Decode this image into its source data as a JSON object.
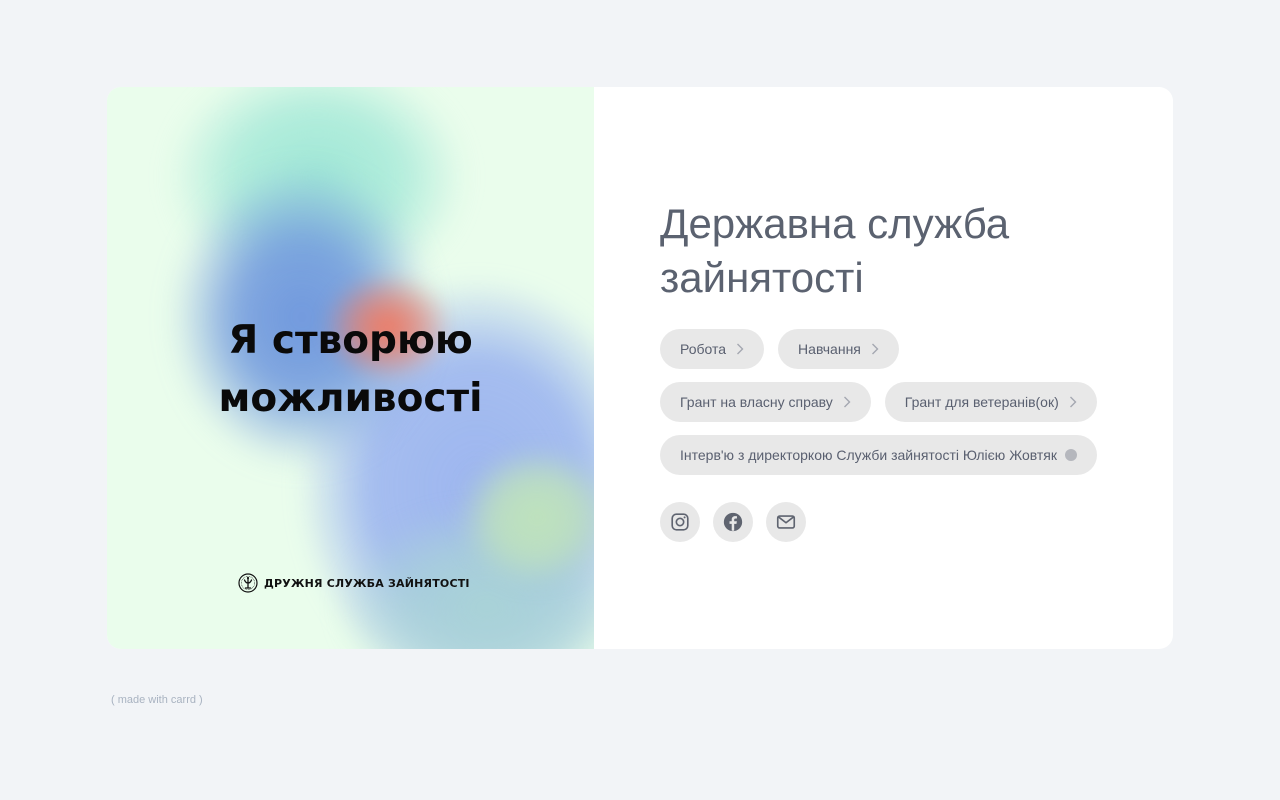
{
  "hero": {
    "headline_line1": "Я створюю",
    "headline_line2": "можливості",
    "logo_text": "ДРУЖНЯ СЛУЖБА ЗАЙНЯТОСТІ"
  },
  "main": {
    "title_line1": "Державна служба",
    "title_line2": "зайнятості",
    "buttons": [
      {
        "label": "Робота",
        "icon": "chevron-right-icon"
      },
      {
        "label": "Навчання",
        "icon": "chevron-right-icon"
      },
      {
        "label": "Грант на власну справу",
        "icon": "chevron-right-icon"
      },
      {
        "label": "Грант для ветеранів(ок)",
        "icon": "chevron-right-icon"
      },
      {
        "label": "Інтерв'ю з директоркою Служби зайнятості Юлією Жовтяк",
        "icon": "dot-icon"
      }
    ],
    "socials": [
      {
        "icon": "instagram-icon"
      },
      {
        "icon": "facebook-icon"
      },
      {
        "icon": "email-icon"
      }
    ]
  },
  "footer": {
    "credit": "( made with carrd )"
  },
  "colors": {
    "page_background": "#f2f4f7",
    "card_background": "#ffffff",
    "title_text": "#5b6270",
    "pill_background": "#e8e8e8",
    "pill_text": "#5a6070",
    "footer_text": "#a9b3c1"
  }
}
